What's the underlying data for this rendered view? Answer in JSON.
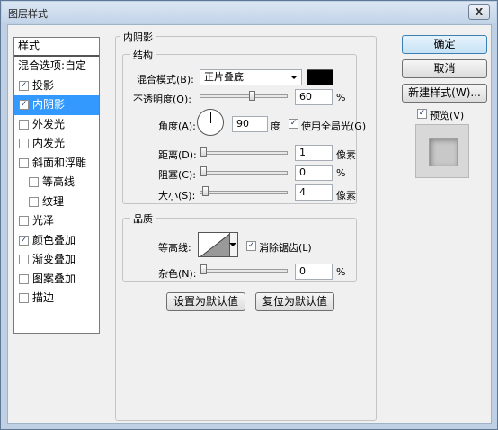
{
  "window": {
    "title": "图层样式",
    "close_glyph": "X"
  },
  "style_list": {
    "header": "样式",
    "blend_options": "混合选项:自定",
    "items": [
      {
        "label": "投影",
        "checked": true,
        "selected": false,
        "sub": false
      },
      {
        "label": "内阴影",
        "checked": true,
        "selected": true,
        "sub": false
      },
      {
        "label": "外发光",
        "checked": false,
        "selected": false,
        "sub": false
      },
      {
        "label": "内发光",
        "checked": false,
        "selected": false,
        "sub": false
      },
      {
        "label": "斜面和浮雕",
        "checked": false,
        "selected": false,
        "sub": false
      },
      {
        "label": "等高线",
        "checked": false,
        "selected": false,
        "sub": true
      },
      {
        "label": "纹理",
        "checked": false,
        "selected": false,
        "sub": true
      },
      {
        "label": "光泽",
        "checked": false,
        "selected": false,
        "sub": false
      },
      {
        "label": "颜色叠加",
        "checked": true,
        "selected": false,
        "sub": false
      },
      {
        "label": "渐变叠加",
        "checked": false,
        "selected": false,
        "sub": false
      },
      {
        "label": "图案叠加",
        "checked": false,
        "selected": false,
        "sub": false
      },
      {
        "label": "描边",
        "checked": false,
        "selected": false,
        "sub": false
      }
    ]
  },
  "panel": {
    "title": "内阴影",
    "structure": {
      "title": "结构",
      "blend_mode_label": "混合模式(B):",
      "blend_mode_value": "正片叠底",
      "color": "#000000",
      "opacity_label": "不透明度(O):",
      "opacity_value": "60",
      "opacity_unit": "%",
      "opacity_fraction": 0.6,
      "angle_label": "角度(A):",
      "angle_value": "90",
      "angle_unit": "度",
      "global_light_label": "使用全局光(G)",
      "global_light_checked": true,
      "distance_label": "距离(D):",
      "distance_value": "1",
      "distance_unit": "像素",
      "choke_label": "阻塞(C):",
      "choke_value": "0",
      "choke_unit": "%",
      "size_label": "大小(S):",
      "size_value": "4",
      "size_unit": "像素"
    },
    "quality": {
      "title": "品质",
      "contour_label": "等高线:",
      "antialias_label": "消除锯齿(L)",
      "antialias_checked": true,
      "noise_label": "杂色(N):",
      "noise_value": "0",
      "noise_unit": "%"
    },
    "set_default": "设置为默认值",
    "reset_default": "复位为默认值"
  },
  "buttons": {
    "ok": "确定",
    "cancel": "取消",
    "new_style": "新建样式(W)...",
    "preview_label": "预览(V)",
    "preview_checked": true
  },
  "check_glyph": "✓"
}
